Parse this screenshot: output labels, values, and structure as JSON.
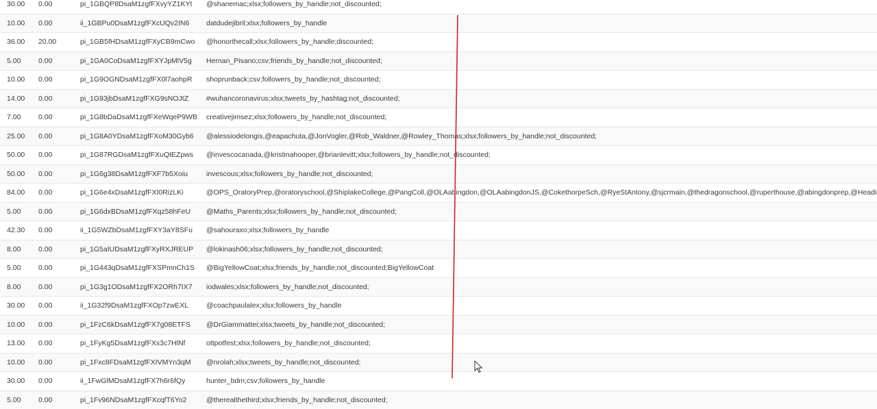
{
  "table": {
    "rows": [
      {
        "amount": "30.00",
        "discount": "0.00",
        "id": "pi_1GBQP8DsaM1zgfFXvyYZ1KYt",
        "desc": "@shanemac;xlsx;followers_by_handle;not_discounted;"
      },
      {
        "amount": "10.00",
        "discount": "0.00",
        "id": "ii_1GBPu0DsaM1zgfFXcUQv2IN6",
        "desc": "datdudejibril;xlsx;followers_by_handle"
      },
      {
        "amount": "36.00",
        "discount": "20.00",
        "id": "pi_1GB5fHDsaM1zgfFXyCB9mCwo",
        "desc": "@honorthecall;xlsx;followers_by_handle;discounted;"
      },
      {
        "amount": "5.00",
        "discount": "0.00",
        "id": "pi_1GA0CoDsaM1zgfFXYJpMlV5g",
        "desc": "Hernan_Pisano;csv;friends_by_handle;not_discounted;"
      },
      {
        "amount": "10.00",
        "discount": "0.00",
        "id": "pi_1G9OGNDsaM1zgfFX0l7aohpR",
        "desc": "shoprunback;csv;followers_by_handle;not_discounted;"
      },
      {
        "amount": "14.00",
        "discount": "0.00",
        "id": "pi_1G93jbDsaM1zgfFXG9sNOJtZ",
        "desc": "#wuhancoronavirus;xlsx;tweets_by_hashtag;not_discounted;"
      },
      {
        "amount": "7.00",
        "discount": "0.00",
        "id": "pi_1G8bDaDsaM1zgfFXeWqeP9WB",
        "desc": "creativejimsez;xlsx;followers_by_handle;not_discounted;"
      },
      {
        "amount": "25.00",
        "discount": "0.00",
        "id": "pi_1G8A0YDsaM1zgfFXoM30Gyb6",
        "desc": "@alessiodelongis,@eapachuta,@JonVogler,@Rob_Waldner,@Rowley_Thomas;xlsx;followers_by_handle;not_discounted;"
      },
      {
        "amount": "50.00",
        "discount": "0.00",
        "id": "pi_1G87RGDsaM1zgfFXuQtEZpws",
        "desc": "@invescocanada,@kristinahooper,@brianlevitt;xlsx;followers_by_handle;not_discounted;"
      },
      {
        "amount": "50.00",
        "discount": "0.00",
        "id": "pi_1G6g38DsaM1zgfFXF7b5Xoiu",
        "desc": "invescous;xlsx;followers_by_handle;not_discounted;"
      },
      {
        "amount": "84.00",
        "discount": "0.00",
        "id": "pi_1G6e4xDsaM1zgfFXI0RizLKi",
        "desc": "@OPS_OratoryPrep,@oratoryschool,@ShiplakeCollege,@PangColl,@OLAabingdon,@OLAabingdonJS,@CokethorpeSch,@RyeStAntony,@sjcrmain,@thedragonschool,@ruperthouse,@abingdonprep,@Headingt"
      },
      {
        "amount": "5.00",
        "discount": "0.00",
        "id": "pi_1G6dxBDsaM1zgfFXqz58hFeU",
        "desc": "@Maths_Parents;xlsx;followers_by_handle;not_discounted;"
      },
      {
        "amount": "42.30",
        "discount": "0.00",
        "id": "ii_1G5WZbDsaM1zgfFXY3aY8SFu",
        "desc": "@sahouraxo;xlsx;followers_by_handle"
      },
      {
        "amount": "8.00",
        "discount": "0.00",
        "id": "pi_1G5aIUDsaM1zgfFXyRXJREUP",
        "desc": "@lokinash06;xlsx;followers_by_handle;not_discounted;"
      },
      {
        "amount": "5.00",
        "discount": "0.00",
        "id": "pi_1G443qDsaM1zgfFXSPmnCh1S",
        "desc": "@BigYellowCoat;xlsx;friends_by_handle;not_discounted;BigYellowCoat"
      },
      {
        "amount": "8.00",
        "discount": "0.00",
        "id": "pi_1G3g1ODsaM1zgfFX2ORh7IX7",
        "desc": "iodwales;xlsx;followers_by_handle;not_discounted;"
      },
      {
        "amount": "30.00",
        "discount": "0.00",
        "id": "ii_1G32f9DsaM1zgfFXOp7zwEXL",
        "desc": "@coachpaulalex;xlsx;followers_by_handle"
      },
      {
        "amount": "10.00",
        "discount": "0.00",
        "id": "pi_1FzC6kDsaM1zgfFX7g08ETFS",
        "desc": "@DrGiammattei;xlsx;tweets_by_handle;not_discounted;"
      },
      {
        "amount": "13.00",
        "discount": "0.00",
        "id": "pi_1FyKg5DsaM1zgfFXs3c7HlNf",
        "desc": "ottpotfest;xlsx;followers_by_handle;not_discounted;"
      },
      {
        "amount": "10.00",
        "discount": "0.00",
        "id": "pi_1Fxc8FDsaM1zgfFXIVMYn3qM",
        "desc": "@nrolah;xlsx;tweets_by_handle;not_discounted;"
      },
      {
        "amount": "30.00",
        "discount": "0.00",
        "id": "ii_1FwGlMDsaM1zgfFX7h6r6fQy",
        "desc": "hunter_bdm;csv;followers_by_handle"
      },
      {
        "amount": "5.00",
        "discount": "0.00",
        "id": "pi_1Fv96NDsaM1zgfFXcqfT6Yo2",
        "desc": "@therealthethird;xlsx;friends_by_handle;not_discounted;"
      }
    ]
  },
  "colors": {
    "annotation": "#d42020",
    "row_alt": "#f9f9f9",
    "text": "#3a3a3a"
  },
  "icons": {
    "cursor": "mouse-pointer-icon"
  }
}
